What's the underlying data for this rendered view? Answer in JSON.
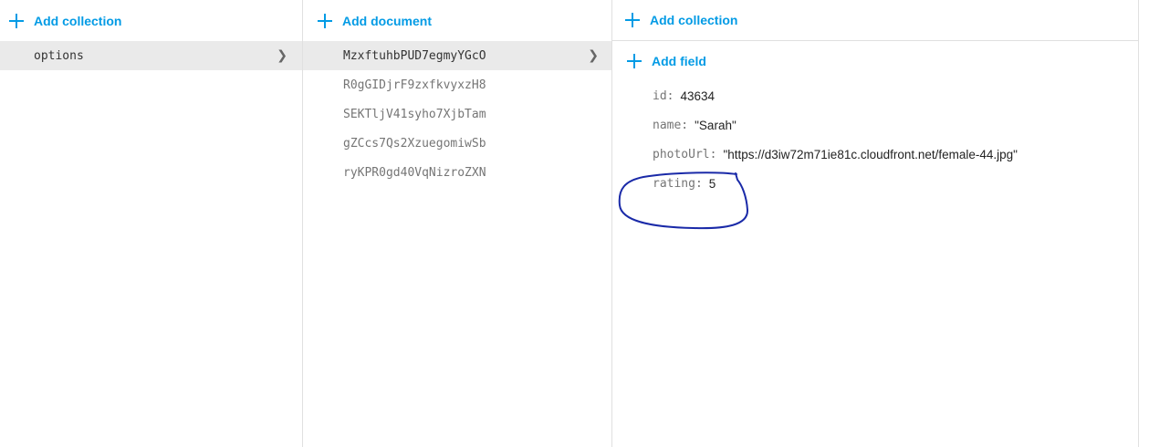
{
  "collections_panel": {
    "add_label": "Add collection",
    "items": [
      {
        "label": "options",
        "selected": true
      }
    ]
  },
  "documents_panel": {
    "add_label": "Add document",
    "items": [
      {
        "label": "MzxftuhbPUD7egmyYGcO",
        "selected": true
      },
      {
        "label": "R0gGIDjrF9zxfkvyxzH8"
      },
      {
        "label": "SEKTljV41syho7XjbTam"
      },
      {
        "label": "gZCcs7Qs2XzuegomiwSb"
      },
      {
        "label": "ryKPR0gd40VqNizroZXN"
      }
    ]
  },
  "fields_panel": {
    "add_collection_label": "Add collection",
    "add_field_label": "Add field",
    "fields": [
      {
        "key": "id:",
        "value": "43634"
      },
      {
        "key": "name:",
        "value": "\"Sarah\""
      },
      {
        "key": "photoUrl:",
        "value": "\"https://d3iw72m71ie81c.cloudfront.net/female-44.jpg\""
      },
      {
        "key": "rating:",
        "value": "5"
      }
    ]
  },
  "colors": {
    "accent": "#039be5",
    "selected_row": "#eaeaea",
    "annotation_ink": "#1a2aa8"
  },
  "icons": {
    "add": "plus-icon",
    "expand": "chevron-right-icon"
  }
}
